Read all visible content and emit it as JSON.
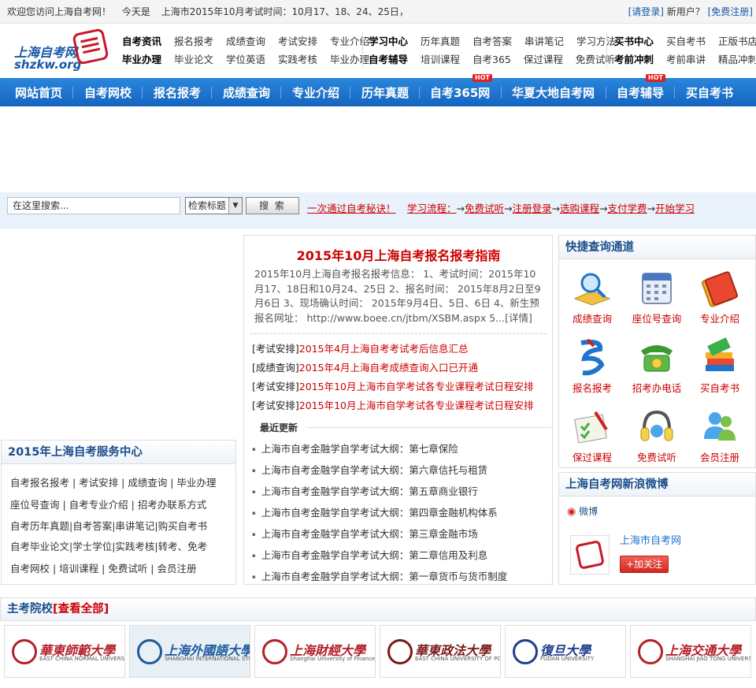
{
  "topbar": {
    "welcome": "欢迎您访问上海自考网！",
    "today": "今天是",
    "exam_time": "上海市2015年10月考试时间：10月17、18、24、25日，",
    "login": "[请登录]",
    "new_user": "新用户？",
    "register": "[免费注册]"
  },
  "logo": {
    "cn": "上海自考网",
    "en": "shzkw.org"
  },
  "header_nav": {
    "group1": {
      "row1": [
        "自考资讯",
        "报名报考",
        "成绩查询",
        "考试安排",
        "专业介绍"
      ],
      "row2": [
        "毕业办理",
        "毕业论文",
        "学位英语",
        "实践考核",
        "毕业办理"
      ]
    },
    "group2": {
      "row1": [
        "学习中心",
        "历年真题",
        "自考答案",
        "串讲笔记",
        "学习方法"
      ],
      "row2": [
        "自考辅导",
        "培训课程",
        "自考365",
        "保过课程",
        "免费试听"
      ]
    },
    "group3": {
      "row1": [
        "买书中心",
        "买自考书",
        "正版书店"
      ],
      "row2": [
        "考前冲刺",
        "考前串讲",
        "精品冲刺"
      ]
    }
  },
  "main_nav": {
    "items": [
      "网站首页",
      "自考网校",
      "报名报考",
      "成绩查询",
      "专业介绍",
      "历年真题",
      "自考365网",
      "华夏大地自考网",
      "自考辅导",
      "买自考书"
    ],
    "hot_badge": "HOT"
  },
  "search": {
    "placeholder": "在这里搜索...",
    "select_value": "检索标题",
    "button": "搜 索",
    "link": "一次通过自考秘诀！",
    "flow_label": "学习流程：",
    "flow_steps": [
      "免费试听",
      "注册登录",
      "选购课程",
      "支付学费",
      "开始学习"
    ],
    "arrow": "→"
  },
  "guide": {
    "title": "2015年10月上海自考报名报考指南",
    "body": "2015年10月上海自考报名报考信息： 1、考试时间：2015年10月17、18日和10月24、25日 2、报名时间： 2015年8月2日至9月6日 3、现场确认时间： 2015年9月4日、5日、6日 4、新生预报名网址： http://www.boee.cn/jtbm/XSBM.aspx 5...[详情]"
  },
  "news": [
    {
      "tag": "[考试安排]",
      "title": "2015年4月上海自考考试考后信息汇总"
    },
    {
      "tag": "[成绩查询]",
      "title": "2015年4月上海自考成绩查询入口已开通"
    },
    {
      "tag": "[考试安排]",
      "title": "2015年10月上海市自学考试各专业课程考试日程安排"
    },
    {
      "tag": "[考试安排]",
      "title": "2015年10月上海市自学考试各专业课程考试日程安排"
    }
  ],
  "recent": {
    "heading": "最近更新",
    "items": [
      "上海市自考金融学自学考试大纲：第七章保险",
      "上海市自考金融学自学考试大纲：第六章信托与租赁",
      "上海市自考金融学自学考试大纲：第五章商业银行",
      "上海市自考金融学自学考试大纲：第四章金融机构体系",
      "上海市自考金融学自学考试大纲：第三章金融市场",
      "上海市自考金融学自学考试大纲：第二章信用及利息",
      "上海市自考金融学自学考试大纲：第一章货币与货币制度"
    ]
  },
  "service": {
    "title": "2015年上海自考服务中心",
    "rows": [
      "自考报名报考 | 考试安排 | 成绩查询 | 毕业办理",
      "座位号查询 | 自考专业介绍 | 招考办联系方式",
      "自考历年真题|自考答案|串讲笔记|购买自考书",
      "自考毕业论文|学士学位|实践考核|转考、免考",
      "自考网校 | 培训课程 | 免费试听 | 会员注册"
    ]
  },
  "quick": {
    "title": "快捷查询通道",
    "items": [
      {
        "label": "成绩查询",
        "icon": "magnifier-book-icon"
      },
      {
        "label": "座位号查询",
        "icon": "calendar-icon"
      },
      {
        "label": "专业介绍",
        "icon": "notebook-icon"
      },
      {
        "label": "报名报考",
        "icon": "signup-logo-icon"
      },
      {
        "label": "招考办电话",
        "icon": "telephone-icon"
      },
      {
        "label": "买自考书",
        "icon": "books-icon"
      },
      {
        "label": "保过课程",
        "icon": "checklist-icon"
      },
      {
        "label": "免费试听",
        "icon": "headphones-icon"
      },
      {
        "label": "会员注册",
        "icon": "users-icon"
      }
    ]
  },
  "weibo": {
    "title": "上海自考网新浪微博",
    "brand": "微博",
    "account": "上海市自考网",
    "follow": "+加关注"
  },
  "schools": {
    "heading": "主考院校",
    "view_all": "[查看全部]",
    "items": [
      {
        "cn": "華東師範大學",
        "en": "EAST CHINA NORMAL UNIVERSITY",
        "color": "#b3202a"
      },
      {
        "cn": "上海外國語大學",
        "en": "SHANGHAI INTERNATIONAL STUDIES UNIVERSITY",
        "color": "#1e5a9c"
      },
      {
        "cn": "上海財經大學",
        "en": "Shanghai University of Finance and Economics",
        "color": "#b3202a"
      },
      {
        "cn": "華東政法大學",
        "en": "EAST CHINA UNIVERSITY OF POLITICAL SCIENCE AND LAW",
        "color": "#7a1a1a"
      },
      {
        "cn": "復旦大學",
        "en": "FUDAN UNIVERSITY",
        "color": "#1e3f8c"
      },
      {
        "cn": "上海交通大學",
        "en": "SHANGHAI JIAO TONG UNIVERSITY",
        "color": "#b3202a"
      }
    ]
  },
  "colors": {
    "brand_blue": "#1f75cc",
    "accent_red": "#cc0000",
    "nav_text": "#ffffff"
  }
}
